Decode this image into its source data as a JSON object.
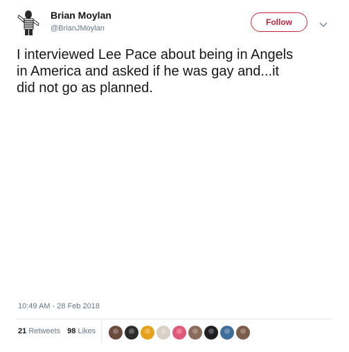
{
  "author": {
    "display_name": "Brian Moylan",
    "handle": "@BrianJMoylan",
    "avatar_icon": "person-striped-shirt-avatar"
  },
  "follow_button": {
    "label": "Follow",
    "color": "#c6283c"
  },
  "menu": {
    "icon": "chevron-down-icon"
  },
  "tweet": {
    "lines": [
      "I interviewed Lee Pace about being in Angels",
      "in America and asked if he was gay and...it",
      "did not go as planned."
    ]
  },
  "meta": {
    "timestamp": "10:49 AM - 28 Feb 2018"
  },
  "stats": {
    "retweets_count": "21",
    "retweets_label": "Retweets",
    "likes_count": "98",
    "likes_label": "Likes"
  },
  "likers": [
    {
      "name": "liker-avatar-1",
      "color": "#6b4a3a"
    },
    {
      "name": "liker-avatar-2",
      "color": "#2b2b2b"
    },
    {
      "name": "liker-avatar-3",
      "color": "#e7a21b"
    },
    {
      "name": "liker-avatar-4",
      "color": "#d9cfc4"
    },
    {
      "name": "liker-avatar-5",
      "color": "#e0587a"
    },
    {
      "name": "liker-avatar-6",
      "color": "#8a6a58"
    },
    {
      "name": "liker-avatar-7",
      "color": "#1f1f1f"
    },
    {
      "name": "liker-avatar-8",
      "color": "#3f6d9c"
    },
    {
      "name": "liker-avatar-9",
      "color": "#7a5c48"
    }
  ]
}
